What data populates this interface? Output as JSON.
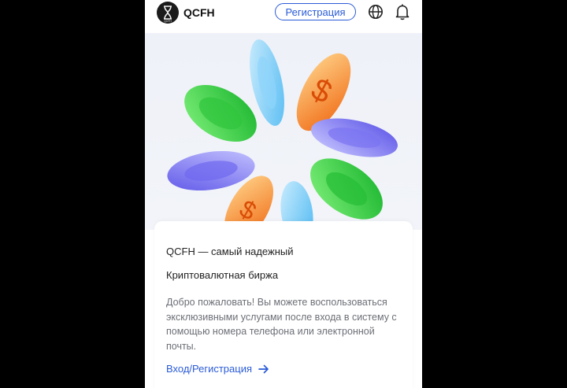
{
  "header": {
    "brand": "QCFH",
    "logo_text": "QCFH",
    "register_button": "Регистрация",
    "icons": [
      "globe-icon",
      "bell-icon"
    ]
  },
  "hero": {
    "image": "crypto-coins-illustration"
  },
  "card": {
    "title_line1": "QCFH — самый надежный",
    "title_line2": "Криптовалютная биржа",
    "description": "Добро пожаловать! Вы можете воспользоваться эксклюзивными услугами после входа в систему с помощью номера телефона или электронной почты.",
    "login_link": "Вход/Регистрация"
  },
  "colors": {
    "accent": "#2a5bd7",
    "text_muted": "#6c6f76",
    "hero_bg": "#eef1f8"
  }
}
